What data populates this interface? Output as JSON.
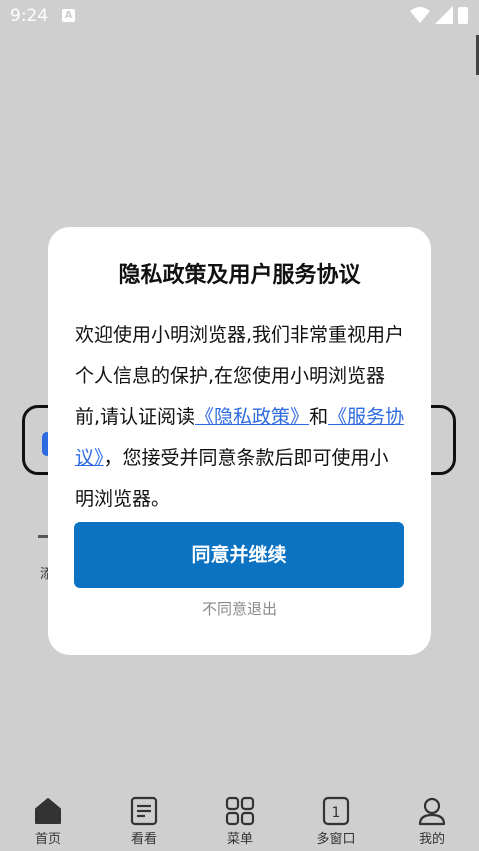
{
  "status_bar": {
    "time": "9:24",
    "notification_icon": "A"
  },
  "dialog": {
    "title": "隐私政策及用户服务协议",
    "body_part1": "欢迎使用小明浏览器,我们非常重视用户个人信息的保护,在您使用小明浏览器前,请认证阅读",
    "privacy_link": "《隐私政策》",
    "body_and": "和",
    "service_link": "《服务协议》",
    "body_part2": "，您接受并同意条款后即可使用小明浏览器。",
    "agree_button": "同意并继续",
    "disagree_button": "不同意退出",
    "accent_color": "#0b73c2",
    "link_color": "#2d6be0"
  },
  "background_page": {
    "partial_text": "添"
  },
  "bottom_nav": {
    "items": [
      {
        "label": "首页",
        "icon": "home-icon"
      },
      {
        "label": "看看",
        "icon": "document-icon"
      },
      {
        "label": "菜单",
        "icon": "grid-icon"
      },
      {
        "label": "多窗口",
        "icon": "windows-icon",
        "count": "1"
      },
      {
        "label": "我的",
        "icon": "user-icon"
      }
    ]
  }
}
